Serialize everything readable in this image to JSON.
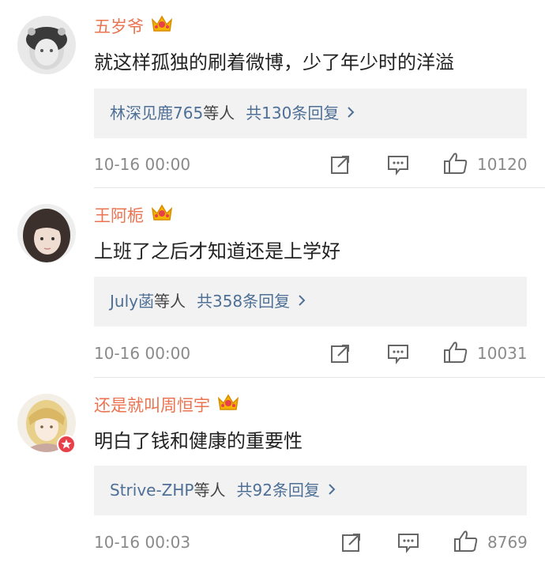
{
  "comments": [
    {
      "username": "五岁爷",
      "text": "就这样孤独的刷着微博，少了年少时的洋溢",
      "reply_user": "林深见鹿765",
      "reply_others": "等人",
      "reply_total": "共130条回复",
      "time": "10-16 00:00",
      "likes": "10120"
    },
    {
      "username": "王阿栀",
      "text": "上班了之后才知道还是上学好",
      "reply_user": "July菡",
      "reply_others": "等人",
      "reply_total": "共358条回复",
      "time": "10-16 00:00",
      "likes": "10031"
    },
    {
      "username": "还是就叫周恒宇",
      "text": "明白了钱和健康的重要性",
      "reply_user": "Strive-ZHP",
      "reply_others": "等人",
      "reply_total": "共92条回复",
      "time": "10-16 00:03",
      "likes": "8769"
    }
  ],
  "colors": {
    "username": "#eb7350",
    "link": "#4e6f96",
    "meta": "#8a8a8a",
    "reply_bg": "#f2f2f2"
  },
  "icons": [
    "crown-badge-icon",
    "chevron-right-icon",
    "share-icon",
    "comment-icon",
    "like-icon",
    "verified-badge-icon"
  ]
}
